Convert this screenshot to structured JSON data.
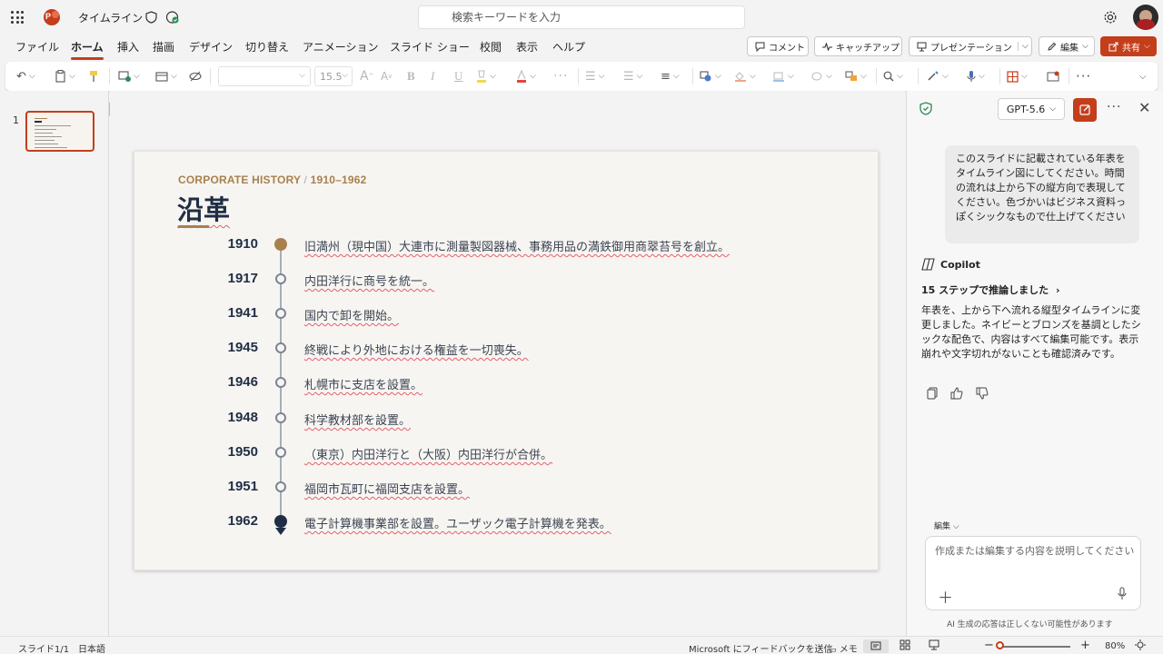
{
  "app": {
    "doc_title": "タイムライン",
    "search_placeholder": "検索キーワードを入力"
  },
  "menu_tabs": [
    "ファイル",
    "ホーム",
    "挿入",
    "描画",
    "デザイン",
    "切り替え",
    "アニメーション",
    "スライド ショー",
    "校閲",
    "表示",
    "ヘルプ"
  ],
  "active_tab": "ホーム",
  "top_buttons": {
    "comment": "コメント",
    "catchup": "キャッチアップ",
    "present": "プレゼンテーション",
    "edit": "編集",
    "share": "共有"
  },
  "ribbon": {
    "font_size": "15.5"
  },
  "thumbnails": {
    "slide_number": "1"
  },
  "slide": {
    "subtitle_left": "CORPORATE HISTORY",
    "subtitle_sep": "/",
    "subtitle_right": "1910–1962",
    "title": "沿革",
    "events": [
      {
        "year": "1910",
        "text": "旧満州（現中国）大連市に測量製図器械、事務用品の満鉄御用商翠苔号を創立。"
      },
      {
        "year": "1917",
        "text": "内田洋行に商号を統一。"
      },
      {
        "year": "1941",
        "text": "国内で卸を開始。"
      },
      {
        "year": "1945",
        "text": "終戦により外地における権益を一切喪失。"
      },
      {
        "year": "1946",
        "text": "札幌市に支店を設置。"
      },
      {
        "year": "1948",
        "text": "科学教材部を設置。"
      },
      {
        "year": "1950",
        "text": "（東京）内田洋行と（大阪）内田洋行が合併。"
      },
      {
        "year": "1951",
        "text": "福岡市瓦町に福岡支店を設置。"
      },
      {
        "year": "1962",
        "text": "電子計算機事業部を設置。ユーザック電子計算機を発表。"
      }
    ]
  },
  "copilot": {
    "model": "GPT-5.6",
    "user_message": "このスライドに記載されている年表をタイムライン図にしてください。時間の流れは上から下の縦方向で表現してください。色づかいはビジネス資料っぽくシックなもので仕上げてください",
    "name": "Copilot",
    "steps": "15 ステップで推論しました",
    "reply": "年表を、上から下へ流れる縦型タイムラインに変更しました。ネイビーとブロンズを基調としたシックな配色で、内容はすべて編集可能です。表示崩れや文字切れがないことも確認済みです。",
    "mode": "編集",
    "input_placeholder": "作成または編集する内容を説明してください",
    "disclaimer": "AI 生成の応答は正しくない可能性があります"
  },
  "status": {
    "slide_count": "スライド1/1",
    "language": "日本語",
    "feedback": "Microsoft にフィードバックを送信",
    "notes": "メモ",
    "zoom": "80%"
  },
  "colors": {
    "accent": "#c43e1c",
    "navy": "#1f2e45",
    "bronze": "#a8804f"
  }
}
